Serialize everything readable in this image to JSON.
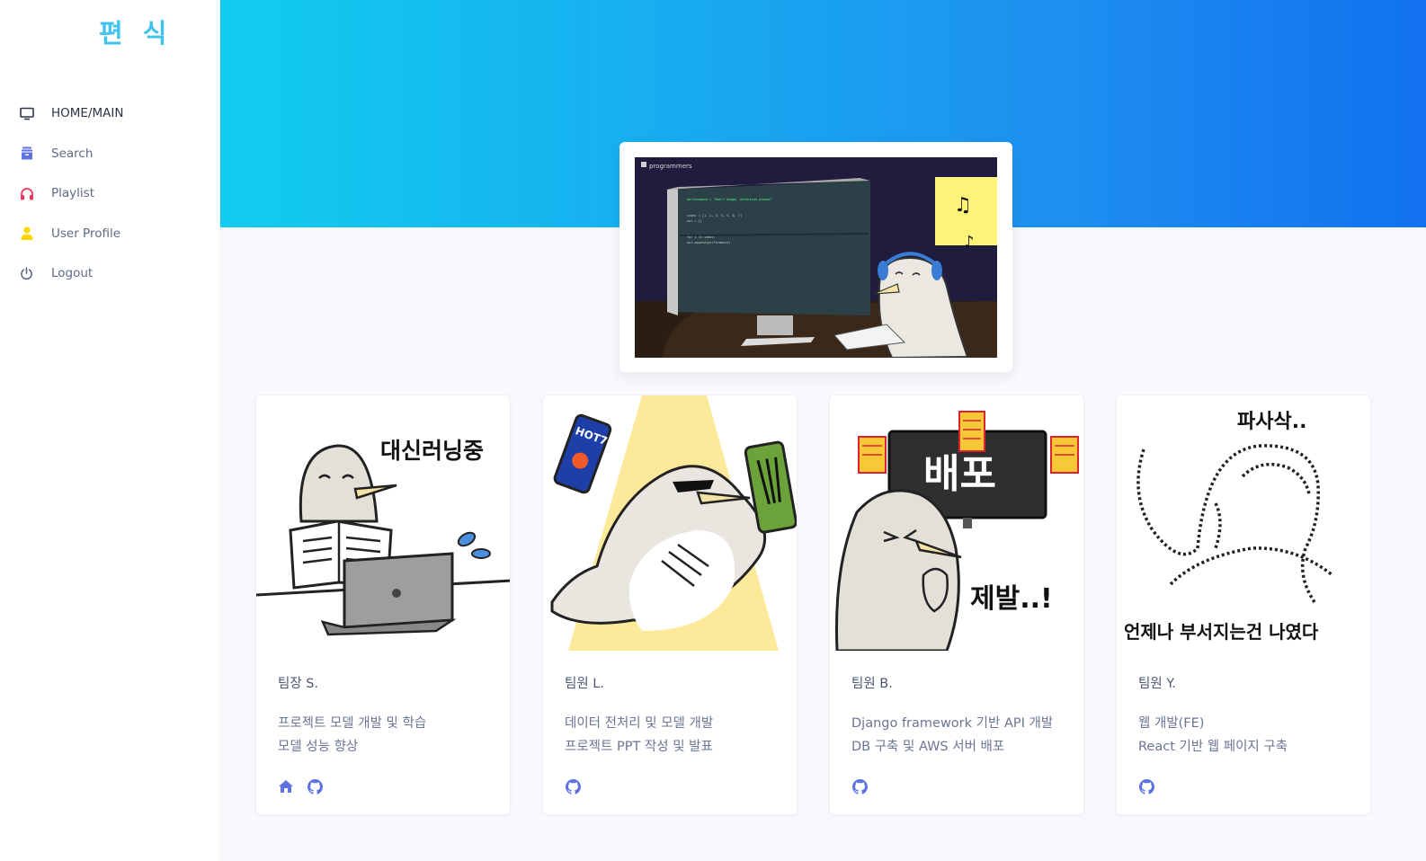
{
  "app": {
    "logo_text": "편 식"
  },
  "sidebar": {
    "items": [
      {
        "label": "HOME/MAIN",
        "icon": "monitor-icon"
      },
      {
        "label": "Search",
        "icon": "archive-icon"
      },
      {
        "label": "Playlist",
        "icon": "headphones-icon"
      },
      {
        "label": "User Profile",
        "icon": "user-icon"
      },
      {
        "label": "Logout",
        "icon": "power-icon"
      }
    ]
  },
  "hero": {
    "image_brand": "programmers",
    "code_lines": [
      "performance = \"Don't dodge, attention please\"",
      "index = [1, 2, 3, 4, 5, 6, 7]",
      "out = []",
      "for i in index:",
      "   out.append(performance)"
    ]
  },
  "team": [
    {
      "name": "팀장 S.",
      "desc": [
        "프로젝트 모델 개발 및 학습",
        "모델 성능 향상"
      ],
      "links": [
        "home-icon",
        "github-icon"
      ],
      "image_caption": "대신러닝중"
    },
    {
      "name": "팀원 L.",
      "desc": [
        "데이터 전처리 및 모델 개발",
        "프로젝트 PPT 작성 및 발표"
      ],
      "links": [
        "github-icon"
      ],
      "image_caption": "HOT7"
    },
    {
      "name": "팀원 B.",
      "desc": [
        "Django framework 기반 API 개발",
        "DB 구축 및 AWS 서버 배포"
      ],
      "links": [
        "github-icon"
      ],
      "image_caption": "배포"
    },
    {
      "name": "팀원 Y.",
      "desc": [
        "웹 개발(FE)",
        "React 기반 웹 페이지 구축"
      ],
      "links": [
        "github-icon"
      ],
      "image_caption": "파사삭.."
    }
  ],
  "colors": {
    "accent": "#5e72e4",
    "hero_start": "#11cdef",
    "hero_end": "#1171ef",
    "logo": "#3fc3ee"
  }
}
